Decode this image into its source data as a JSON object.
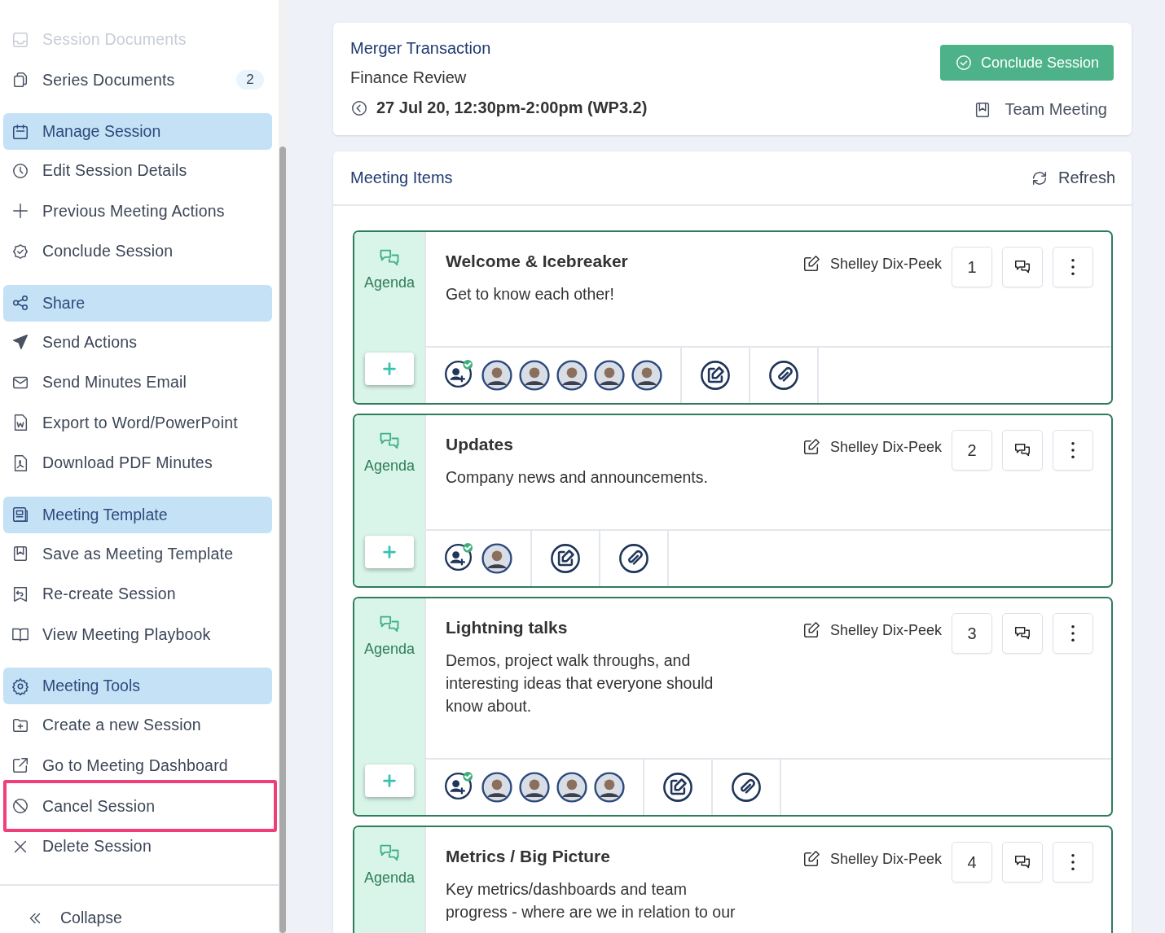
{
  "sidebar": {
    "items": [
      {
        "kind": "item",
        "label": "Session Documents",
        "disabled": true
      },
      {
        "kind": "item",
        "label": "Series Documents",
        "badge": "2",
        "disabled": false
      },
      {
        "kind": "header",
        "label": "Manage Session"
      },
      {
        "kind": "item",
        "label": "Edit Session Details",
        "disabled": false
      },
      {
        "kind": "item",
        "label": "Previous Meeting Actions",
        "disabled": false
      },
      {
        "kind": "item",
        "label": "Conclude Session",
        "disabled": false
      },
      {
        "kind": "header",
        "label": "Share"
      },
      {
        "kind": "item",
        "label": "Send Actions",
        "disabled": false
      },
      {
        "kind": "item",
        "label": "Send Minutes Email",
        "disabled": false
      },
      {
        "kind": "item",
        "label": "Export to Word/PowerPoint",
        "disabled": false
      },
      {
        "kind": "item",
        "label": "Download PDF Minutes",
        "disabled": false
      },
      {
        "kind": "header",
        "label": "Meeting Template"
      },
      {
        "kind": "item",
        "label": "Save as Meeting Template",
        "disabled": false
      },
      {
        "kind": "item",
        "label": "Re-create Session",
        "disabled": false
      },
      {
        "kind": "item",
        "label": "View Meeting Playbook",
        "disabled": false
      },
      {
        "kind": "header",
        "label": "Meeting Tools"
      },
      {
        "kind": "item",
        "label": "Create a new Session",
        "disabled": false
      },
      {
        "kind": "item",
        "label": "Go to Meeting Dashboard",
        "disabled": false
      },
      {
        "kind": "item",
        "label": "Cancel Session",
        "disabled": false,
        "highlighted": true
      },
      {
        "kind": "item",
        "label": "Delete Session",
        "disabled": false
      }
    ],
    "collapse": "Collapse"
  },
  "session": {
    "title": "Merger Transaction",
    "subtitle": "Finance Review",
    "time": "27 Jul 20, 12:30pm-2:00pm (WP3.2)",
    "conclude_button": "Conclude Session",
    "meeting_type": "Team Meeting"
  },
  "meeting_items": {
    "title": "Meeting Items",
    "refresh": "Refresh",
    "items": [
      {
        "type": "Agenda",
        "title": "Welcome & Icebreaker",
        "description": "Get to know each other!",
        "owner": "Shelley Dix-Peek",
        "number": "1"
      },
      {
        "type": "Agenda",
        "title": "Updates",
        "description": "Company news and announcements.",
        "owner": "Shelley Dix-Peek",
        "number": "2"
      },
      {
        "type": "Agenda",
        "title": "Lightning talks",
        "description": "Demos, project walk throughs, and interesting ideas that everyone should know about.",
        "owner": "Shelley Dix-Peek",
        "number": "3"
      },
      {
        "type": "Agenda",
        "title": "Metrics / Big Picture",
        "description": "Key metrics/dashboards and team progress - where are we in relation to our",
        "owner": "Shelley Dix-Peek",
        "number": "4"
      }
    ]
  }
}
